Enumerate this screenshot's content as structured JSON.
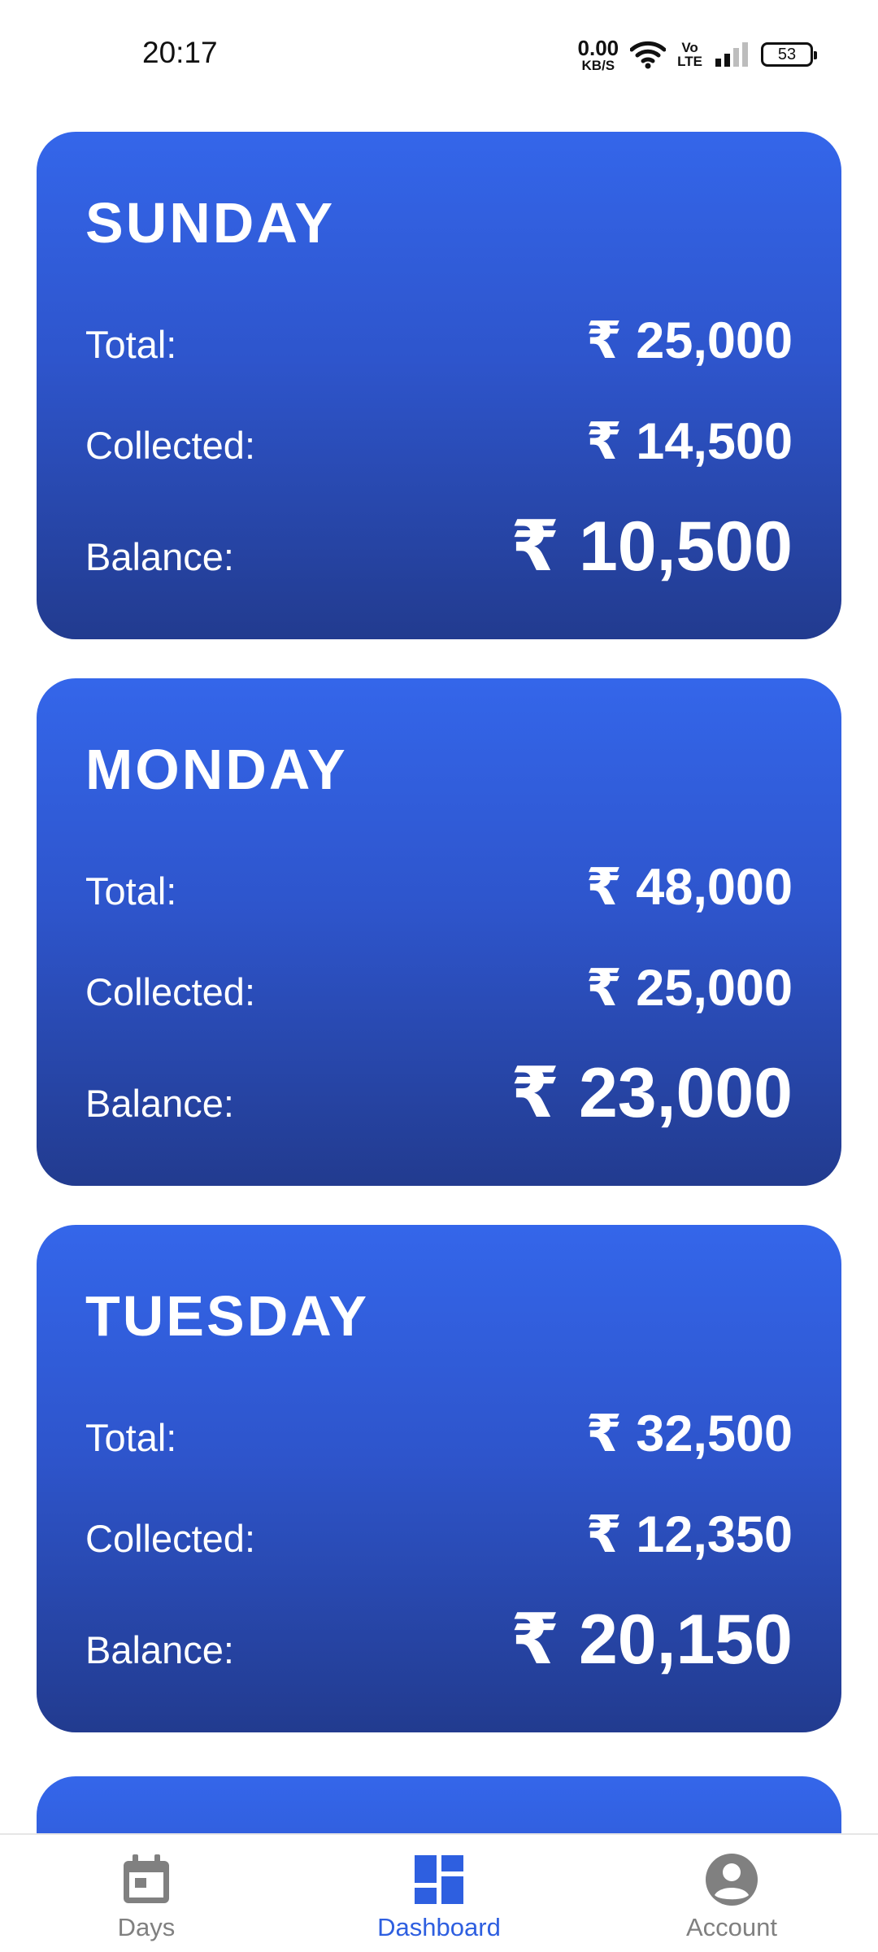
{
  "status_bar": {
    "time": "20:17",
    "net_speed_value": "0.00",
    "net_speed_unit": "KB/S",
    "volte_top": "Vo",
    "volte_bottom": "LTE",
    "battery": "53",
    "icons": [
      "wifi-icon",
      "signal-icon",
      "battery-icon"
    ]
  },
  "cards": [
    {
      "day": "SUNDAY",
      "total_label": "Total:",
      "total": "₹ 25,000",
      "collected_label": "Collected:",
      "collected": "₹ 14,500",
      "balance_label": "Balance:",
      "balance": "₹ 10,500"
    },
    {
      "day": "MONDAY",
      "total_label": "Total:",
      "total": "₹ 48,000",
      "collected_label": "Collected:",
      "collected": "₹ 25,000",
      "balance_label": "Balance:",
      "balance": "₹ 23,000"
    },
    {
      "day": "TUESDAY",
      "total_label": "Total:",
      "total": "₹ 32,500",
      "collected_label": "Collected:",
      "collected": "₹ 12,350",
      "balance_label": "Balance:",
      "balance": "₹ 20,150"
    }
  ],
  "bottom_nav": {
    "items": [
      {
        "label": "Days",
        "icon": "calendar-icon",
        "active": false
      },
      {
        "label": "Dashboard",
        "icon": "dashboard-icon",
        "active": true
      },
      {
        "label": "Account",
        "icon": "account-icon",
        "active": false
      }
    ]
  },
  "colors": {
    "card_top": "#3466ea",
    "card_bottom": "#223b8f",
    "nav_active": "#2e5fe0",
    "nav_inactive": "#808080"
  }
}
